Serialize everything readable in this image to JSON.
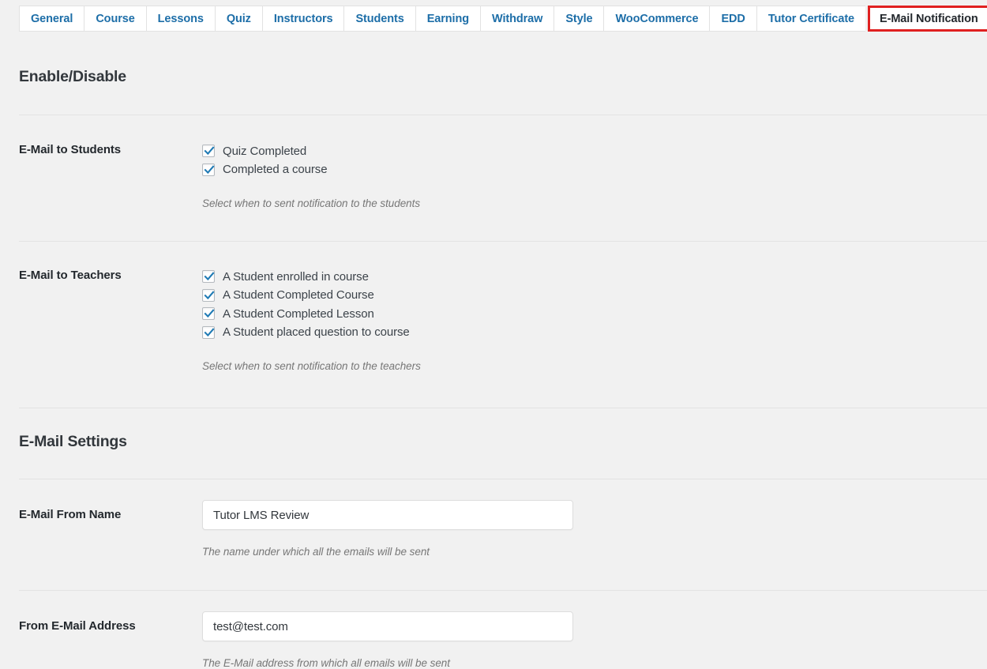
{
  "tabs": [
    {
      "label": "General",
      "active": false
    },
    {
      "label": "Course",
      "active": false
    },
    {
      "label": "Lessons",
      "active": false
    },
    {
      "label": "Quiz",
      "active": false
    },
    {
      "label": "Instructors",
      "active": false
    },
    {
      "label": "Students",
      "active": false
    },
    {
      "label": "Earning",
      "active": false
    },
    {
      "label": "Withdraw",
      "active": false
    },
    {
      "label": "Style",
      "active": false
    },
    {
      "label": "WooCommerce",
      "active": false
    },
    {
      "label": "EDD",
      "active": false
    },
    {
      "label": "Tutor Certificate",
      "active": false
    },
    {
      "label": "E-Mail Notification",
      "active": true
    }
  ],
  "colors": {
    "tab_link": "#1d6ea8",
    "active_tab_outline": "#e02020",
    "checkbox_check": "#1f7ab4",
    "page_background": "#f1f1f1"
  },
  "sections": [
    {
      "heading": "Enable/Disable",
      "fields": [
        {
          "label": "E-Mail to Students",
          "options": [
            {
              "label": "Quiz Completed",
              "checked": true
            },
            {
              "label": "Completed a course",
              "checked": true
            }
          ],
          "help": "Select when to sent notification to the students"
        },
        {
          "label": "E-Mail to Teachers",
          "options": [
            {
              "label": "A Student enrolled in course",
              "checked": true
            },
            {
              "label": "A Student Completed Course",
              "checked": true
            },
            {
              "label": "A Student Completed Lesson",
              "checked": true
            },
            {
              "label": "A Student placed question to course",
              "checked": true
            }
          ],
          "help": "Select when to sent notification to the teachers"
        }
      ]
    },
    {
      "heading": "E-Mail Settings",
      "fields": [
        {
          "label": "E-Mail From Name",
          "value": "Tutor LMS Review",
          "placeholder": "",
          "help": "The name under which all the emails will be sent"
        },
        {
          "label": "From E-Mail Address",
          "value": "test@test.com",
          "placeholder": "",
          "help": "The E-Mail address from which all emails will be sent"
        }
      ]
    }
  ]
}
